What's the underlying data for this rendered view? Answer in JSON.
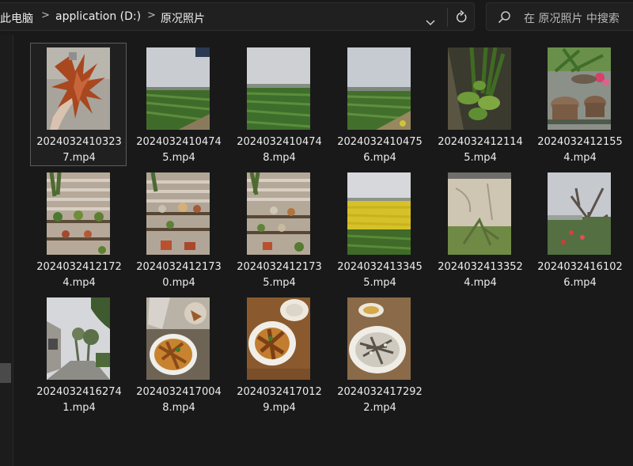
{
  "breadcrumb": {
    "items": [
      "此电脑",
      "application (D:)",
      "原况照片"
    ],
    "separator": ">"
  },
  "address_bar": {
    "dropdown_icon": "chevron-down-icon",
    "refresh_icon": "refresh-icon"
  },
  "search": {
    "placeholder": "在 原况照片 中搜索",
    "icon": "search-icon"
  },
  "files": [
    "20240324103237.mp4",
    "20240324104745.mp4",
    "20240324104748.mp4",
    "20240324104756.mp4",
    "20240324121145.mp4",
    "20240324121554.mp4",
    "20240324121724.mp4",
    "20240324121730.mp4",
    "20240324121735.mp4",
    "20240324133455.mp4",
    "20240324133524.mp4",
    "20240324161026.mp4",
    "20240324162741.mp4",
    "20240324170048.mp4",
    "20240324170129.mp4",
    "20240324172922.mp4"
  ],
  "colors": {
    "background": "#191919",
    "bar": "#202020",
    "selected_border": "#5c5c5c",
    "text": "#ececec"
  }
}
